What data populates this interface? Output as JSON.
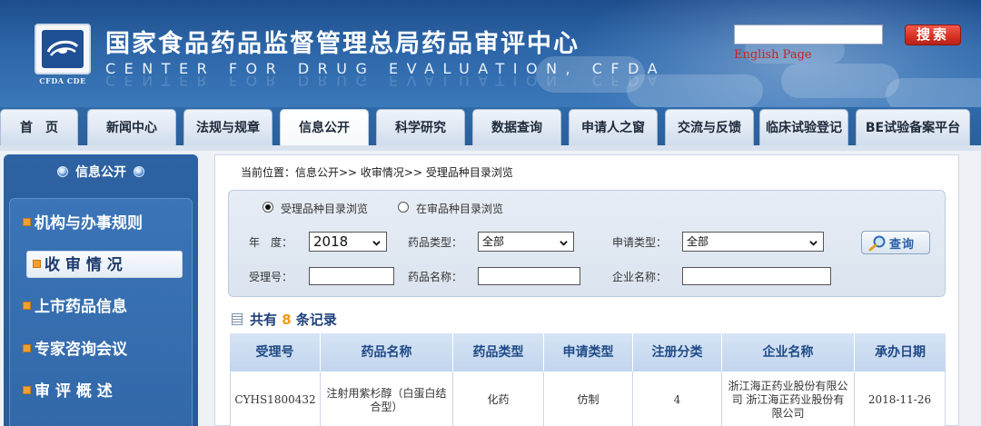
{
  "header": {
    "logo_caption": "CFDA CDE",
    "title": "国家食品药品监督管理总局药品审评中心",
    "subtitle": "CENTER FOR DRUG EVALUATION, CFDA",
    "search": {
      "value": "",
      "button_label": "搜索"
    },
    "english_link": "English Page"
  },
  "nav": {
    "items": [
      {
        "label": "首　页"
      },
      {
        "label": "新闻中心"
      },
      {
        "label": "法规与规章"
      },
      {
        "label": "信息公开"
      },
      {
        "label": "科学研究"
      },
      {
        "label": "数据查询"
      },
      {
        "label": "申请人之窗"
      },
      {
        "label": "交流与反馈"
      },
      {
        "label": "临床试验登记"
      },
      {
        "label": "BE试验备案平台"
      }
    ],
    "active_index": 3
  },
  "sidebar": {
    "heading": "信息公开",
    "items": [
      {
        "label": "机构与办事规则"
      },
      {
        "label": "收 审 情 况"
      },
      {
        "label": "上市药品信息"
      },
      {
        "label": "专家咨询会议"
      },
      {
        "label": "审 评 概 述"
      }
    ],
    "active_index": 1
  },
  "breadcrumb": "当前位置：信息公开>> 收审情况>> 受理品种目录浏览",
  "filters": {
    "radio_options": [
      {
        "label": "受理品种目录浏览",
        "selected": true
      },
      {
        "label": "在审品种目录浏览",
        "selected": false
      }
    ],
    "year_label": "年　度：",
    "year_value": "2018",
    "drug_type_label": "药品类型：",
    "drug_type_value": "全部",
    "apply_type_label": "申请类型：",
    "apply_type_value": "全部",
    "accept_no_label": "受理号：",
    "accept_no_value": "",
    "drug_name_label": "药品名称：",
    "drug_name_value": "",
    "company_label": "企业名称：",
    "company_value": "",
    "query_button": "查询"
  },
  "results": {
    "count_prefix": "共有",
    "count": "8",
    "count_suffix": "条记录",
    "columns": [
      "受理号",
      "药品名称",
      "药品类型",
      "申请类型",
      "注册分类",
      "企业名称",
      "承办日期"
    ],
    "rows": [
      [
        "CYHS1800432",
        "注射用紫杉醇（白蛋白结合型）",
        "化药",
        "仿制",
        "4",
        "浙江海正药业股份有限公司 浙江海正药业股份有限公司",
        "2018-11-26"
      ]
    ]
  },
  "colors": {
    "header_blue": "#2d66a8",
    "search_red": "#d62f22",
    "link_red": "#c8241c",
    "count_orange": "#f19a17",
    "table_header": "#c2d5ee"
  }
}
